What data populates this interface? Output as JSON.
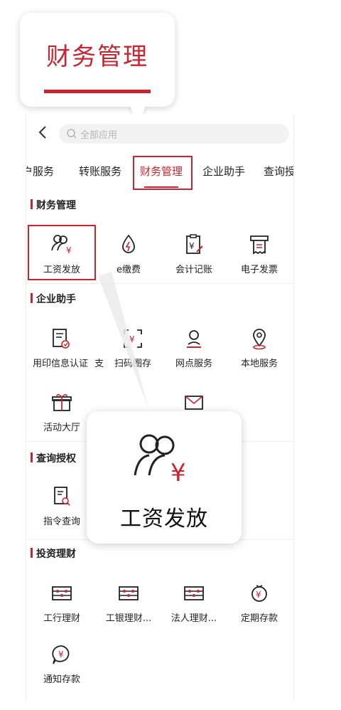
{
  "callout_title": "财务管理",
  "search": {
    "placeholder": "全部应用"
  },
  "tabs": [
    "户服务",
    "转账服务",
    "财务管理",
    "企业助手",
    "查询授权"
  ],
  "sections": {
    "finance": {
      "title": "财务管理",
      "items": [
        "工资发放",
        "e缴费",
        "会计记账",
        "电子发票"
      ]
    },
    "assistant": {
      "title": "企业助手",
      "items": [
        "用印信息认证",
        "支",
        "扫码圈存",
        "网点服务",
        "本地服务",
        "活动大厅"
      ]
    },
    "query": {
      "title": "查询授权",
      "items": [
        "指令查询"
      ]
    },
    "invest": {
      "title": "投资理财",
      "items": [
        "工行理财",
        "工银理财...",
        "法人理财...",
        "定期存款",
        "通知存款"
      ]
    }
  },
  "zoom_label": "工资发放",
  "colors": {
    "accent": "#c9242f",
    "text": "#222222",
    "muted": "#b5b5b5"
  }
}
